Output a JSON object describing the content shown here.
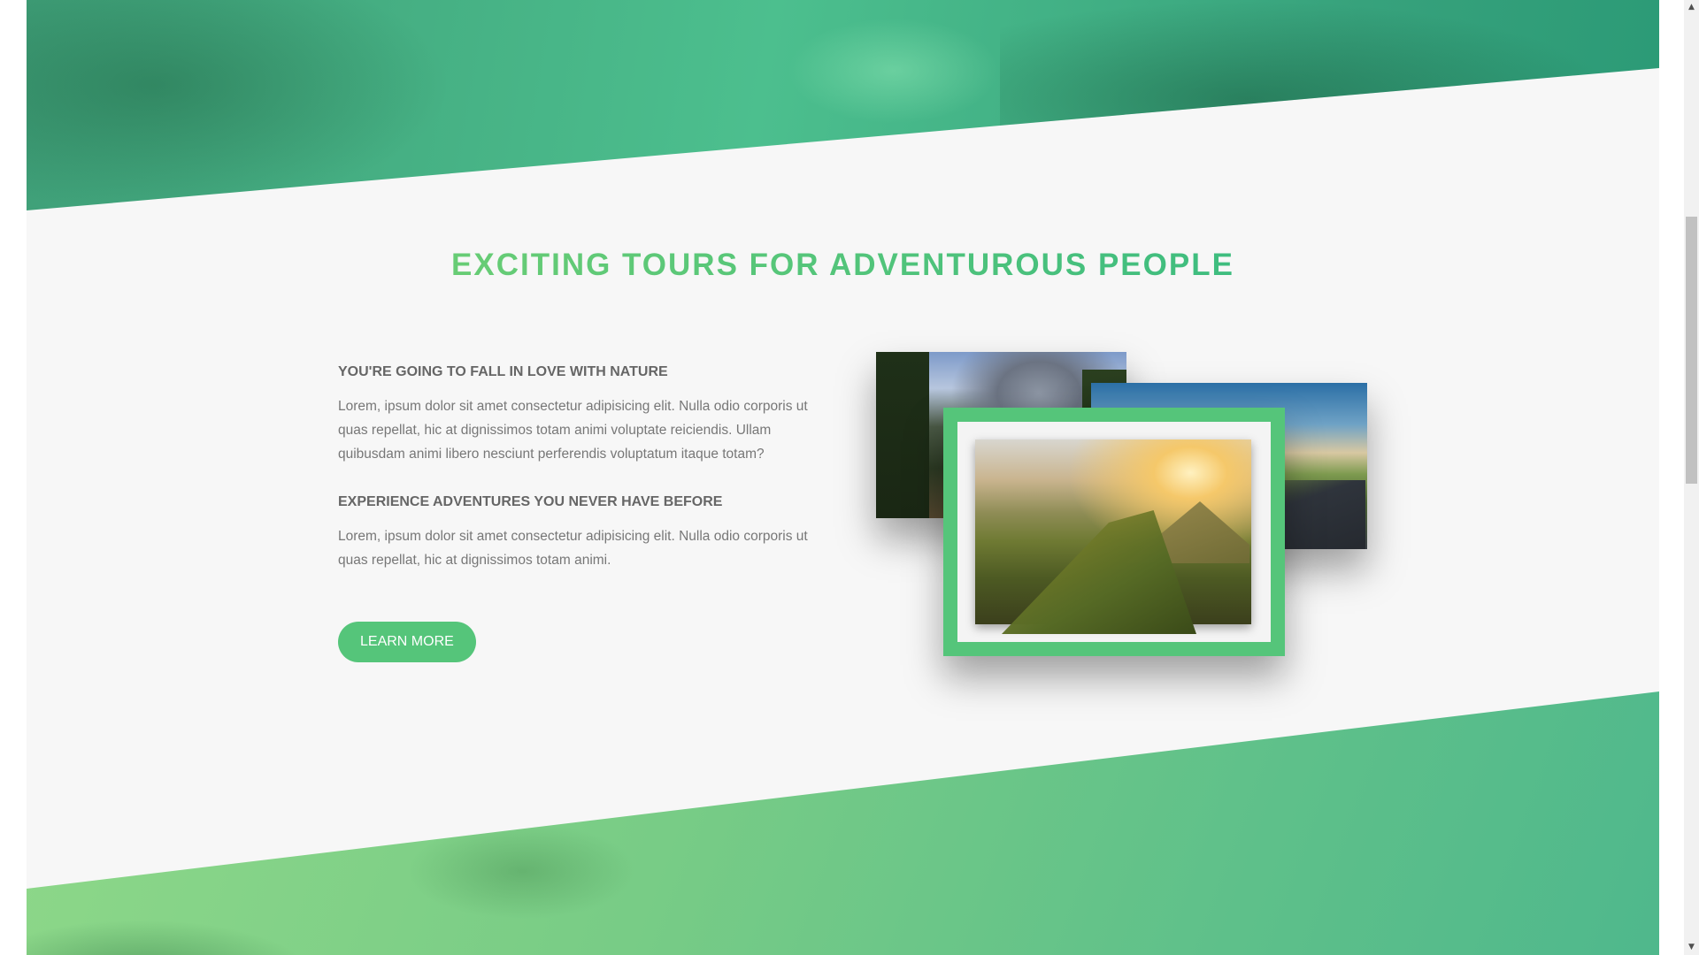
{
  "section": {
    "title": "EXCITING TOURS FOR ADVENTUROUS PEOPLE",
    "block1": {
      "heading": "YOU'RE GOING TO FALL IN LOVE WITH NATURE",
      "body": "Lorem, ipsum dolor sit amet consectetur adipisicing elit. Nulla odio corporis ut quas repellat, hic at dignissimos totam animi voluptate reiciendis. Ullam quibusdam animi libero nesciunt perferendis voluptatum itaque totam?"
    },
    "block2": {
      "heading": "EXPERIENCE ADVENTURES YOU NEVER HAVE BEFORE",
      "body": "Lorem, ipsum dolor sit amet consectetur adipisicing elit. Nulla odio corporis ut quas repellat, hic at dignissimos totam animi."
    },
    "button_label": "LEARN MORE"
  },
  "colors": {
    "primary": "#55c57a",
    "gradient_start": "#7ed56f",
    "gradient_end": "#28b485",
    "background": "#f7f7f7",
    "text": "#777777"
  },
  "scrollbar": {
    "up_icon": "chevron-up-icon",
    "down_icon": "chevron-down-icon"
  }
}
